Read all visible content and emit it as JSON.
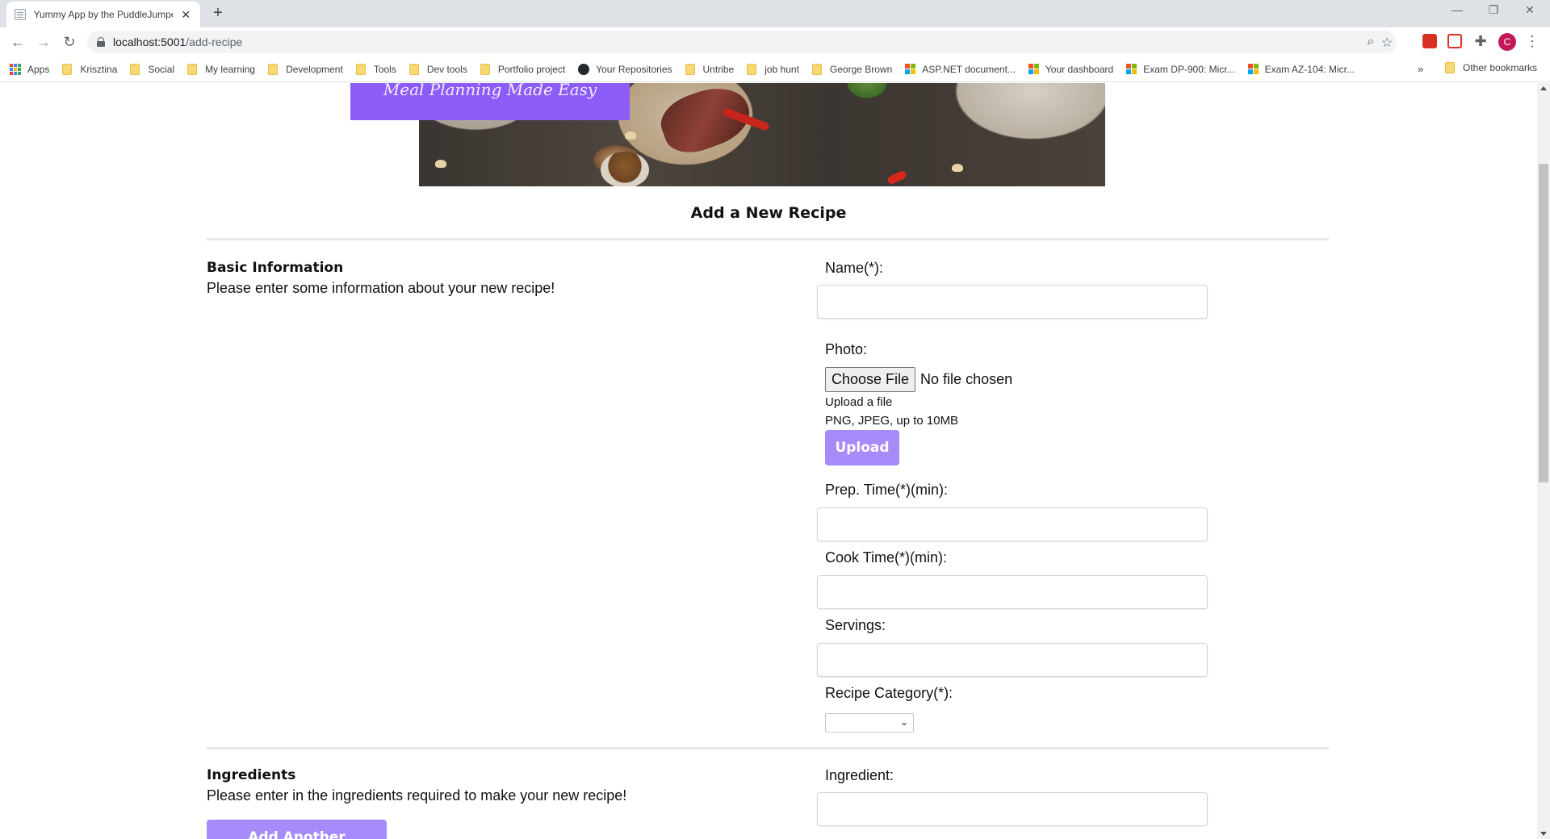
{
  "browser": {
    "tab_title": "Yummy App by the PuddleJumpers",
    "url_host": "localhost:5001",
    "url_path": "/add-recipe",
    "profile_initial": "C",
    "bookmarks": [
      "Apps",
      "Krisztina",
      "Social",
      "My learning",
      "Development",
      "Tools",
      "Dev tools",
      "Portfolio project",
      "Your Repositories",
      "Untribe",
      "job hunt",
      "George Brown",
      "ASP.NET document...",
      "Your dashboard",
      "Exam DP-900: Micr...",
      "Exam AZ-104: Micr..."
    ],
    "bookmarks_more": "»",
    "other_bookmarks": "Other bookmarks"
  },
  "hero": {
    "tagline": "Meal Planning Made Easy",
    "brand_color": "#8b5cf6"
  },
  "page": {
    "title": "Add a New Recipe"
  },
  "basic": {
    "heading": "Basic Information",
    "description": "Please enter some information about your new recipe!",
    "name_label": "Name(*):",
    "name_value": "",
    "photo_label": "Photo:",
    "choose_file_label": "Choose File",
    "no_file_text": "No file chosen",
    "upload_hint": "Upload a file",
    "format_hint": "PNG, JPEG, up to 10MB",
    "upload_label": "Upload",
    "prep_label": "Prep. Time(*)(min):",
    "prep_value": "",
    "cook_label": "Cook Time(*)(min):",
    "cook_value": "",
    "servings_label": "Servings:",
    "servings_value": "",
    "category_label": "Recipe Category(*):",
    "category_value": ""
  },
  "ingredients": {
    "heading": "Ingredients",
    "description": "Please enter in the ingredients required to make your new recipe!",
    "add_label": "Add Another Ingredient",
    "ingredient_label": "Ingredient:",
    "ingredient_value": ""
  },
  "colors": {
    "button": "#a78bfa",
    "divider": "#e5e7eb"
  }
}
